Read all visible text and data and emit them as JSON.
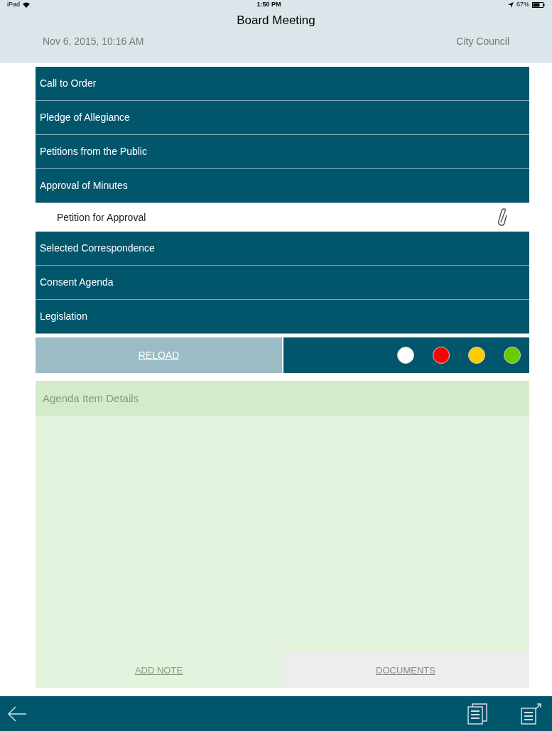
{
  "status_bar": {
    "device": "iPad",
    "time": "1:50 PM",
    "battery": "67%"
  },
  "header": {
    "title": "Board Meeting",
    "date": "Nov 6, 2015, 10:16 AM",
    "body": "City Council"
  },
  "agenda": [
    {
      "kind": "section",
      "label": "Call to Order"
    },
    {
      "kind": "section",
      "label": "Pledge of Allegiance"
    },
    {
      "kind": "section",
      "label": "Petitions from the Public"
    },
    {
      "kind": "section",
      "label": "Approval of Minutes"
    },
    {
      "kind": "item",
      "label": "Petition for Approval",
      "attachment": true
    },
    {
      "kind": "section",
      "label": "Selected Correspondence"
    },
    {
      "kind": "section",
      "label": "Consent Agenda"
    },
    {
      "kind": "section",
      "label": "Legislation"
    }
  ],
  "reload": "RELOAD",
  "status_dots": [
    {
      "color": "#ffffff"
    },
    {
      "color": "#ff0000"
    },
    {
      "color": "#ffcc00"
    },
    {
      "color": "#66cc00"
    }
  ],
  "details": {
    "title": "Agenda Item Details",
    "add_note": "ADD NOTE",
    "documents": "DOCUMENTS"
  }
}
